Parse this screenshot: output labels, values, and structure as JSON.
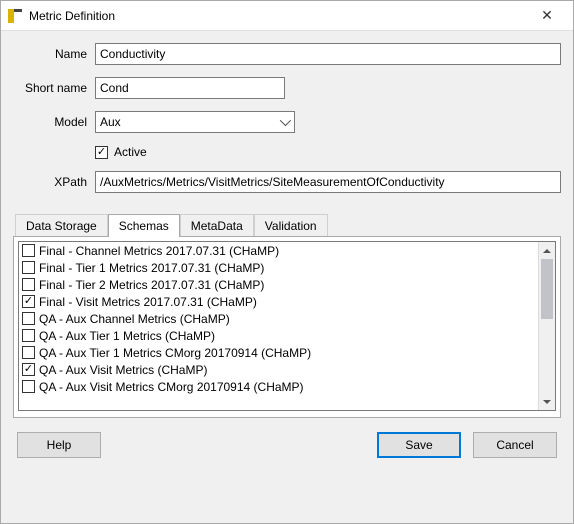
{
  "window": {
    "title": "Metric Definition"
  },
  "form": {
    "name_label": "Name",
    "name_value": "Conductivity",
    "short_label": "Short name",
    "short_value": "Cond",
    "model_label": "Model",
    "model_value": "Aux",
    "active_label": "Active",
    "active_checked": true,
    "xpath_label": "XPath",
    "xpath_value": "/AuxMetrics/Metrics/VisitMetrics/SiteMeasurementOfConductivity"
  },
  "tabs": {
    "items": [
      {
        "label": "Data Storage",
        "active": false
      },
      {
        "label": "Schemas",
        "active": true
      },
      {
        "label": "MetaData",
        "active": false
      },
      {
        "label": "Validation",
        "active": false
      }
    ]
  },
  "schemas": {
    "items": [
      {
        "label": "Final - Channel Metrics 2017.07.31 (CHaMP)",
        "checked": false
      },
      {
        "label": "Final - Tier 1 Metrics 2017.07.31 (CHaMP)",
        "checked": false
      },
      {
        "label": "Final - Tier 2 Metrics 2017.07.31 (CHaMP)",
        "checked": false
      },
      {
        "label": "Final - Visit Metrics 2017.07.31 (CHaMP)",
        "checked": true
      },
      {
        "label": "QA - Aux Channel Metrics (CHaMP)",
        "checked": false
      },
      {
        "label": "QA - Aux Tier 1 Metrics (CHaMP)",
        "checked": false
      },
      {
        "label": "QA - Aux Tier 1 Metrics CMorg 20170914 (CHaMP)",
        "checked": false
      },
      {
        "label": "QA - Aux Visit Metrics (CHaMP)",
        "checked": true
      },
      {
        "label": "QA - Aux Visit Metrics CMorg 20170914 (CHaMP)",
        "checked": false
      }
    ]
  },
  "buttons": {
    "help": "Help",
    "save": "Save",
    "cancel": "Cancel"
  }
}
